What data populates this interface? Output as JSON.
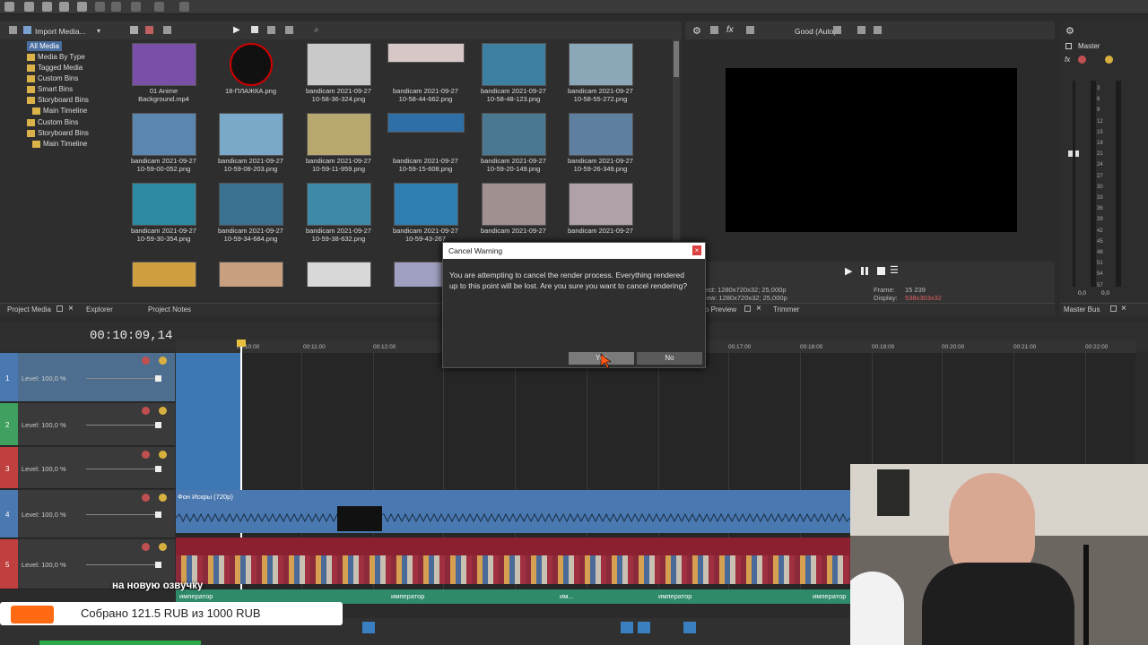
{
  "media": {
    "import_label": "Import Media...",
    "tree": [
      {
        "label": "All Media",
        "selected": true
      },
      {
        "label": "Media By Type"
      },
      {
        "label": "Tagged Media"
      },
      {
        "label": "Custom Bins"
      },
      {
        "label": "Smart Bins"
      },
      {
        "label": "Storyboard Bins"
      },
      {
        "label": "Main Timeline"
      },
      {
        "label": "Custom Bins"
      },
      {
        "label": "Storyboard Bins"
      },
      {
        "label": "Main Timeline"
      }
    ],
    "thumbs": [
      {
        "line1": "01 Anime",
        "line2": "Background.mp4",
        "color": "#7a4fa8"
      },
      {
        "line1": "18-ПЛАЖКА.png",
        "line2": "",
        "color": "#111111"
      },
      {
        "line1": "bandicam 2021-09-27",
        "line2": "10-58-36-324.png",
        "color": "#c9c9c9"
      },
      {
        "line1": "bandicam 2021-09-27",
        "line2": "10-58-44-662.png",
        "color": "#d7c7c7"
      },
      {
        "line1": "bandicam 2021-09-27",
        "line2": "10-58-48-123.png",
        "color": "#3d7fa0"
      },
      {
        "line1": "bandicam 2021-09-27",
        "line2": "10-58-55-272.png",
        "color": "#8aa8b8"
      },
      {
        "line1": "bandicam 2021-09-27",
        "line2": "10-59-00-052.png",
        "color": "#5a86b0"
      },
      {
        "line1": "bandicam 2021-09-27",
        "line2": "10-59-08-203.png",
        "color": "#7aa8c8"
      },
      {
        "line1": "bandicam 2021-09-27",
        "line2": "10-59-11-959.png",
        "color": "#b8a870"
      },
      {
        "line1": "bandicam 2021-09-27",
        "line2": "10-59-15-608.png",
        "color": "#2f6fa8"
      },
      {
        "line1": "bandicam 2021-09-27",
        "line2": "10-59-20-149.png",
        "color": "#4a7890"
      },
      {
        "line1": "bandicam 2021-09-27",
        "line2": "10-59-26-349.png",
        "color": "#5f7fa0"
      },
      {
        "line1": "bandicam 2021-09-27",
        "line2": "10-59-30-354.png",
        "color": "#2e8aa0"
      },
      {
        "line1": "bandicam 2021-09-27",
        "line2": "10-59-34-684.png",
        "color": "#3a7090"
      },
      {
        "line1": "bandicam 2021-09-27",
        "line2": "10-59-38-632.png",
        "color": "#3f8aa8"
      },
      {
        "line1": "bandicam 2021-09-27",
        "line2": "10-59-43-267",
        "color": "#2f7fb0"
      },
      {
        "line1": "bandicam 2021-09-27",
        "line2": "",
        "color": "#a09090"
      },
      {
        "line1": "bandicam 2021-09-27",
        "line2": "",
        "color": "#b0a0a8"
      },
      {
        "line1": "",
        "line2": "",
        "color": "#d0a040"
      },
      {
        "line1": "",
        "line2": "",
        "color": "#c8a080"
      },
      {
        "line1": "",
        "line2": "",
        "color": "#d8d8d8"
      },
      {
        "line1": "",
        "line2": "",
        "color": "#a0a0c0"
      }
    ],
    "tabs": [
      "Project Media",
      "Explorer",
      "Project Notes"
    ]
  },
  "preview": {
    "quality": "Good (Auto)",
    "project_line": "ect:  1280x720x32; 25,000p",
    "preview_line": "iew:  1280x720x32; 25,000p",
    "frame_label": "Frame:",
    "frame_value": "15 239",
    "display_label": "Display:",
    "display_value": "538x303x32",
    "tabs": [
      "o Preview",
      "Trimmer"
    ]
  },
  "master": {
    "label": "Master",
    "bus_label": "Master Bus",
    "ticks": [
      "3",
      "6",
      "9",
      "12",
      "15",
      "18",
      "21",
      "24",
      "27",
      "30",
      "33",
      "36",
      "39",
      "42",
      "45",
      "48",
      "51",
      "54",
      "57"
    ],
    "bottom_left": "0,0",
    "bottom_right": "0,0"
  },
  "timeline": {
    "timecode": "00:10:09,14",
    "ruler": [
      "00:10:00",
      "00:11:00",
      "00:12:00",
      "00:17:00",
      "00:18:00",
      "00:19:00",
      "00:20:00",
      "00:21:00",
      "00:22:00"
    ],
    "tracks": [
      {
        "num": "1",
        "level": "Level: 100,0 %",
        "color": "#4a78b0"
      },
      {
        "num": "2",
        "level": "Level: 100,0 %",
        "color": "#3fa060"
      },
      {
        "num": "3",
        "level": "Level: 100,0 %",
        "color": "#c04040"
      },
      {
        "num": "4",
        "level": "Level: 100,0 %",
        "color": "#4a78b0"
      },
      {
        "num": "5",
        "level": "Level: 100,0 %",
        "color": "#c04040"
      }
    ],
    "clip_track4": "Фон Искры (720p)",
    "clip_track6": [
      "император",
      "император",
      "им...",
      "император",
      "император"
    ]
  },
  "dialog": {
    "title": "Cancel Warning",
    "message": "You are attempting to cancel the render process. Everything rendered up to this point will be lost. Are you sure you want to cancel rendering?",
    "yes_label": "Yes",
    "no_label": "No"
  },
  "overlay": {
    "caption": "на новую озвучку",
    "donation": "Собрано 121.5 RUB из 1000 RUB"
  }
}
